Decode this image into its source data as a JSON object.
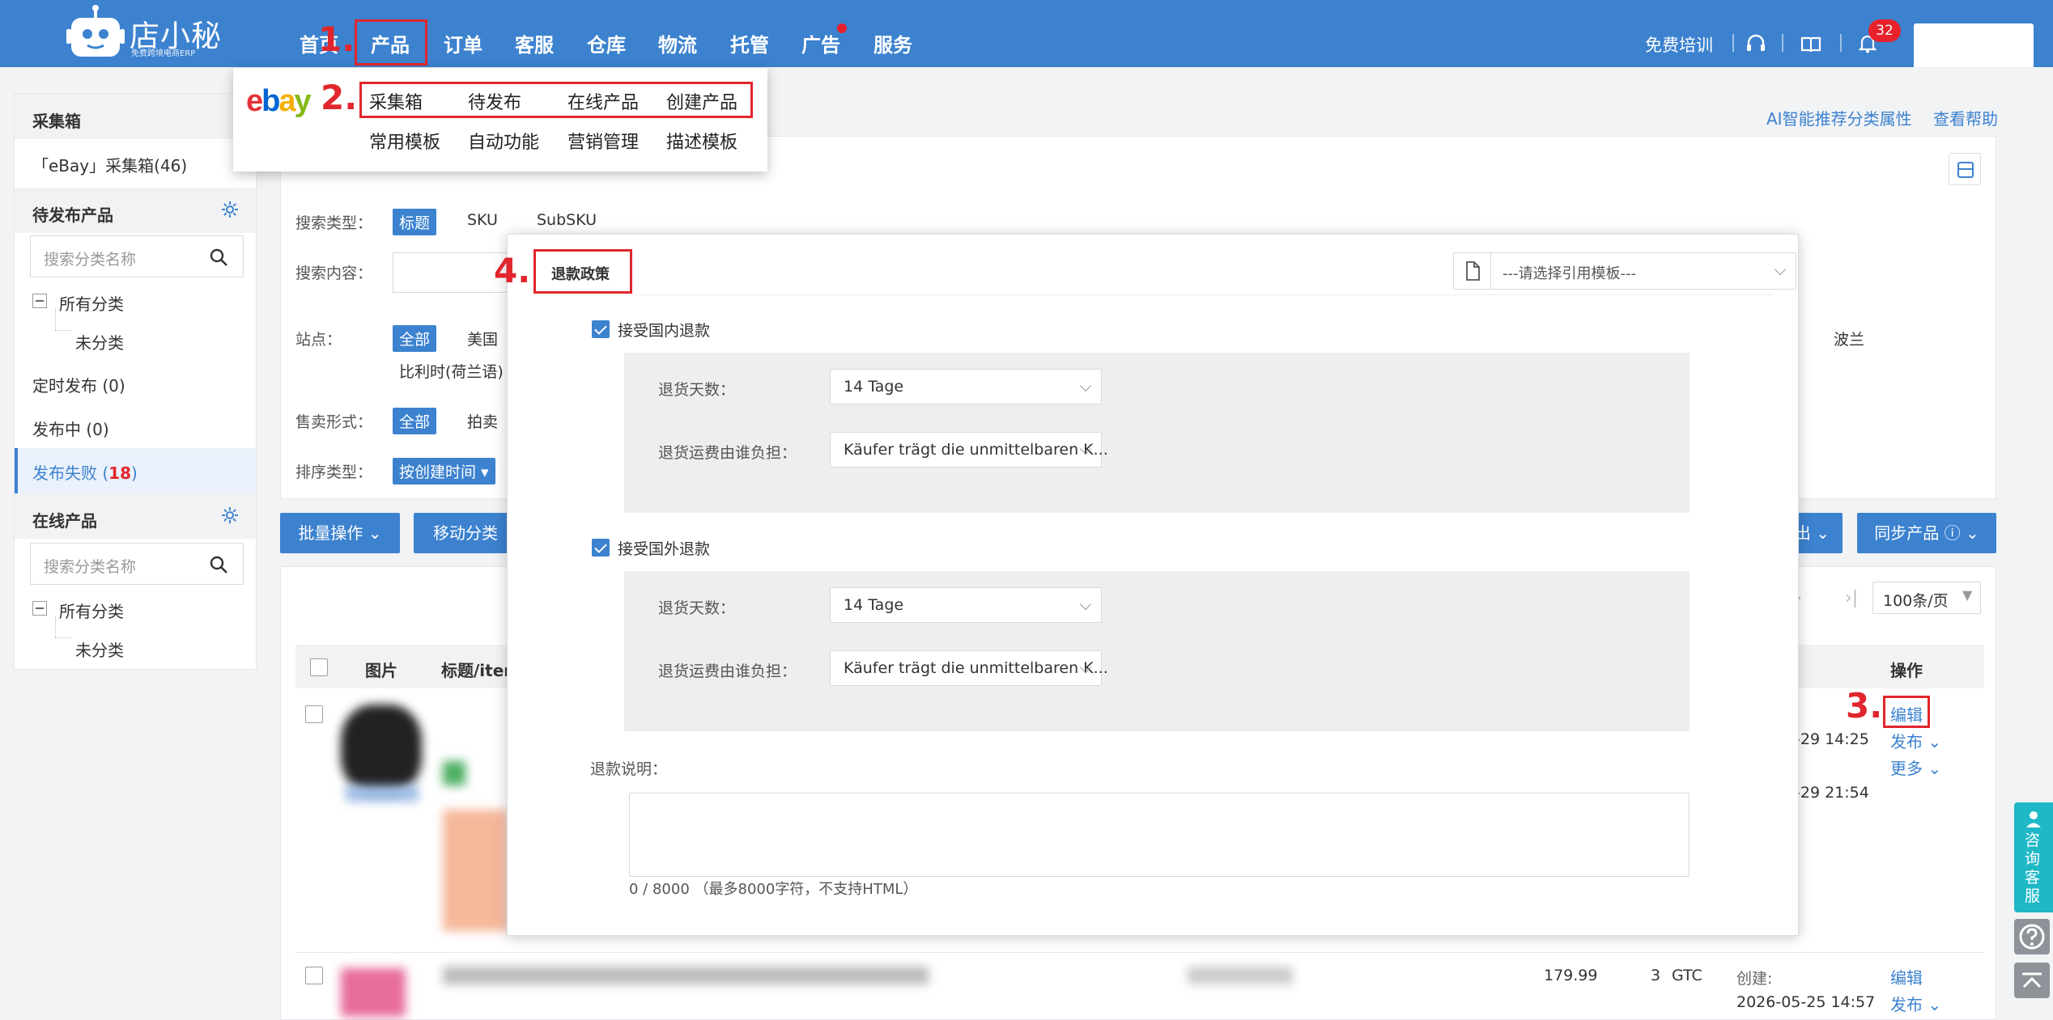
{
  "header": {
    "logo_text": "店小秘",
    "logo_sub": "免费跨境电商ERP",
    "nav": [
      "首页",
      "产品",
      "订单",
      "客服",
      "仓库",
      "物流",
      "托管",
      "广告",
      "服务"
    ],
    "training": "免费培训",
    "notify_count": "32"
  },
  "annotations": {
    "a1": "1.",
    "a2": "2.",
    "a3": "3.",
    "a4": "4."
  },
  "dropdown": {
    "brand": "ebay",
    "row1": [
      "采集箱",
      "待发布",
      "在线产品",
      "创建产品"
    ],
    "row2": [
      "常用模板",
      "自动功能",
      "营销管理",
      "描述模板"
    ]
  },
  "sidebar": {
    "collect_head": "采集箱",
    "collect_item": "「eBay」采集箱(46)",
    "pending_head": "待发布产品",
    "search_placeholder": "搜索分类名称",
    "all_cat": "所有分类",
    "uncat": "未分类",
    "scheduled": "定时发布 (0)",
    "publishing": "发布中 (0)",
    "failed_label": "发布失败 (",
    "failed_count": "18",
    "failed_close": ")",
    "online_head": "在线产品",
    "search_placeholder2": "搜索分类名称",
    "all_cat2": "所有分类",
    "uncat2": "未分类"
  },
  "topright": {
    "ai_link": "AI智能推荐分类属性",
    "help": "查看帮助"
  },
  "filters": {
    "search_type_label": "搜索类型：",
    "search_type_opts": [
      "标题",
      "SKU",
      "SubSKU"
    ],
    "content_label": "搜索内容：",
    "site_label": "站点：",
    "site_all": "全部",
    "site_us": "美国",
    "site_pl": "波兰",
    "site_be": "比利时(荷兰语)",
    "sale_label": "售卖形式：",
    "sale_all": "全部",
    "sale_auction": "拍卖",
    "sort_label": "排序类型：",
    "sort_value": "按创建时间 ▾"
  },
  "toolbar": {
    "batch": "批量操作",
    "move": "移动分类",
    "export": "出",
    "sync": "同步产品",
    "page_size": "100条/页"
  },
  "table": {
    "col_img": "图片",
    "col_title": "标题/item",
    "col_ops": "操作",
    "row1": {
      "time1": "-29 14:25",
      "time2": "-29 21:54",
      "edit": "编辑",
      "publish": "发布",
      "more": "更多"
    },
    "row2": {
      "price": "179.99",
      "qty": "3",
      "dur": "GTC",
      "created_label": "创建:",
      "created": "2026-05-25 14:57",
      "edit": "编辑",
      "publish": "发布"
    }
  },
  "modal": {
    "tab_title": "退款政策",
    "template_placeholder": "---请选择引用模板---",
    "domestic": {
      "label": "接受国内退款",
      "days_label": "退货天数：",
      "days_value": "14 Tage",
      "cost_label": "退货运费由谁负担：",
      "cost_value": "Käufer trägt die unmittelbaren K..."
    },
    "intl": {
      "label": "接受国外退款",
      "days_label": "退货天数：",
      "days_value": "14 Tage",
      "cost_label": "退货运费由谁负担：",
      "cost_value": "Käufer trägt die unmittelbaren K..."
    },
    "desc_label": "退款说明：",
    "counter": "0 / 8000 （最多8000字符，不支持HTML）"
  },
  "float": {
    "cs": [
      "咨",
      "询",
      "客",
      "服"
    ]
  }
}
